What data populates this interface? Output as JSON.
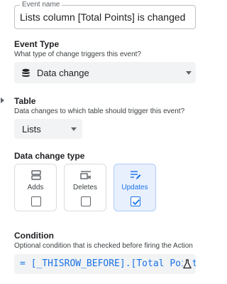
{
  "event_name": {
    "label": "Event name",
    "value": "Lists column [Total Points] is changed"
  },
  "event_type": {
    "title": "Event Type",
    "hint": "What type of change triggers this event?",
    "icon": "database-icon",
    "selected": "Data change"
  },
  "table": {
    "title": "Table",
    "hint": "Data changes to which table should trigger this event?",
    "selected": "Lists"
  },
  "data_change_type": {
    "title": "Data change type",
    "options": [
      {
        "label": "Adds",
        "icon": "add-row-icon",
        "checked": false
      },
      {
        "label": "Deletes",
        "icon": "delete-row-icon",
        "checked": false
      },
      {
        "label": "Updates",
        "icon": "edit-list-icon",
        "checked": true
      }
    ]
  },
  "condition": {
    "title": "Condition",
    "hint": "Optional condition that is checked before firing the Action",
    "value": "= [_THISROW_BEFORE].[Total Points",
    "icon": "flask-icon"
  },
  "colors": {
    "accent": "#1a73e8",
    "field_bg": "#f1f3f4",
    "selected_card_bg": "#e8f0fe"
  }
}
